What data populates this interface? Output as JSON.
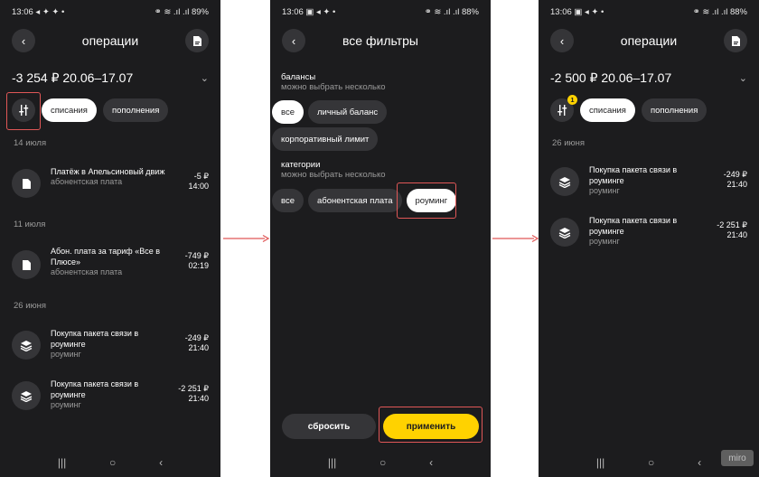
{
  "screen1": {
    "status_left": "13:06 ◂ ✦ ✦ •",
    "status_right": "⚭ ≋ .ıl .ıl 89%",
    "title": "операции",
    "summary": "-3 254 ₽ 20.06–17.07",
    "chips": [
      "списания",
      "пополнения"
    ],
    "groups": [
      {
        "date": "14 июля",
        "items": [
          {
            "title": "Платёж в Апельсиновый движ",
            "category": "абонентская плата",
            "amount": "-5 ₽",
            "time": "14:00"
          }
        ]
      },
      {
        "date": "11 июля",
        "items": [
          {
            "title": "Абон. плата за тариф «Все в Плюсе»",
            "category": "абонентская плата",
            "amount": "-749 ₽",
            "time": "02:19"
          }
        ]
      },
      {
        "date": "26 июня",
        "items": [
          {
            "title": "Покупка пакета связи в роуминге",
            "category": "роуминг",
            "amount": "-249 ₽",
            "time": "21:40"
          },
          {
            "title": "Покупка пакета связи в роуминге",
            "category": "роуминг",
            "amount": "-2 251 ₽",
            "time": "21:40"
          }
        ]
      }
    ]
  },
  "screen2": {
    "status_left": "13:06 ▣ ◂ ✦ •",
    "status_right": "⚭ ≋ .ıl .ıl 88%",
    "title": "все фильтры",
    "balances_title": "балансы",
    "balances_sub": "можно выбрать несколько",
    "balances_chips": [
      "все",
      "личный баланс",
      "корпоративный лимит"
    ],
    "categories_title": "категории",
    "categories_sub": "можно выбрать несколько",
    "categories_chips": [
      "все",
      "абонентская плата",
      "роуминг"
    ],
    "reset_label": "сбросить",
    "apply_label": "применить"
  },
  "screen3": {
    "status_left": "13:06 ▣ ◂ ✦ •",
    "status_right": "⚭ ≋ .ıl .ıl 88%",
    "title": "операции",
    "summary": "-2 500 ₽ 20.06–17.07",
    "badge": "1",
    "chips": [
      "списания",
      "пополнения"
    ],
    "date": "26 июня",
    "items": [
      {
        "title": "Покупка пакета связи в роуминге",
        "category": "роуминг",
        "amount": "-249 ₽",
        "time": "21:40"
      },
      {
        "title": "Покупка пакета связи в роуминге",
        "category": "роуминг",
        "amount": "-2 251 ₽",
        "time": "21:40"
      }
    ]
  },
  "nav": {
    "recent": "|||",
    "home": "○",
    "back": "‹"
  },
  "icons": {
    "back": "chevron-left-icon",
    "doc": "document-icon",
    "filter": "sliders-icon"
  },
  "colors": {
    "background": "#1c1c1e",
    "surface": "#353538",
    "accent": "#ffd200",
    "highlight": "#e05757"
  },
  "watermark": "miro"
}
